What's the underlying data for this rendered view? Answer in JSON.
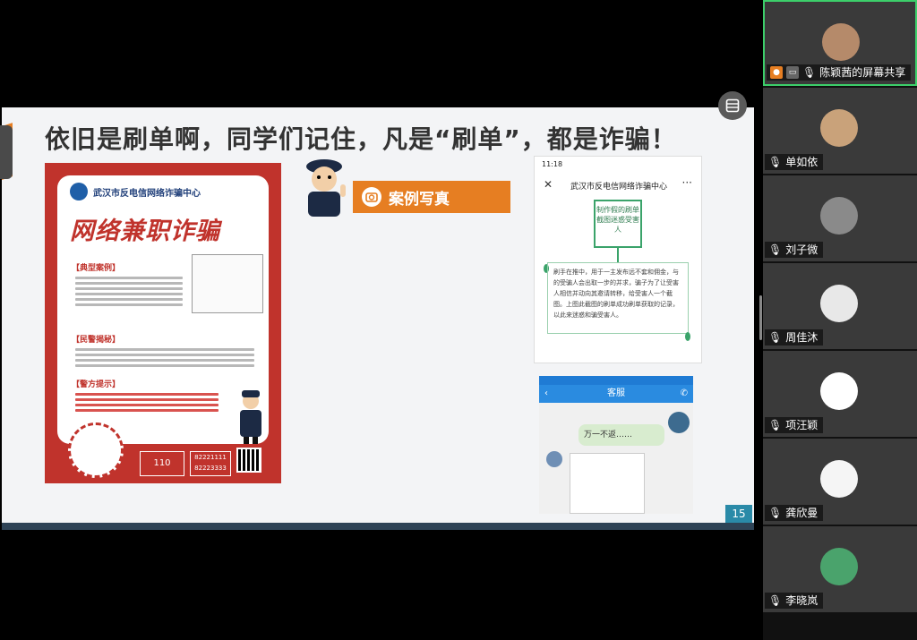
{
  "slide": {
    "title": "依旧是刷单啊，同学们记住，凡是“刷单”，都是诈骗！",
    "page_number": "15",
    "poster": {
      "org": "武汉市反电信网络诈骗中心",
      "title": "网络兼职诈骗",
      "sections": [
        "【典型案例】",
        "【民警揭秘】",
        "【警方提示】"
      ],
      "hotline": "110",
      "phones": [
        "82221111",
        "82223333"
      ]
    },
    "banner": "案例写真",
    "phone1": {
      "status_time": "11:18",
      "title": "武汉市反电信网络诈骗中心",
      "box_text": "制作假的刷单截图迷惑受害人",
      "paragraph": "刷手在推中，用于一主发布远不套和佣金，与的受骗人会出取一步的并求，骗子为了让受害人相信并动向其邀请转移，给受害人一个截图。上图此截图的刷单成功刷单获取的记录，以此来迷惑和骗受害人。"
    },
    "phone2": {
      "nav_title": "客服",
      "bubble": "万一不返……"
    }
  },
  "participants": [
    {
      "name": "陈颖茜的屏幕共享",
      "active": true,
      "avatar_color": "#b58a6a"
    },
    {
      "name": "单如依",
      "avatar_color": "#c9a27a"
    },
    {
      "name": "刘子微",
      "avatar_color": "#8a8a8a"
    },
    {
      "name": "周佳沐",
      "avatar_color": "#e8e8e8"
    },
    {
      "name": "项汪颖",
      "avatar_color": "#ffffff"
    },
    {
      "name": "龚欣曼",
      "avatar_color": "#f5f5f5"
    },
    {
      "name": "李晓岚",
      "avatar_color": "#4aa36c"
    }
  ]
}
